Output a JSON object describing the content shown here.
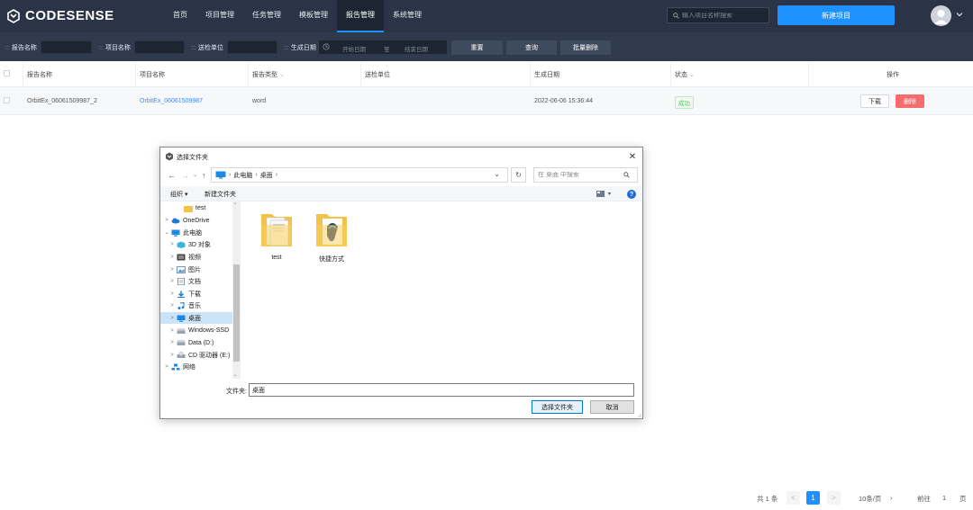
{
  "app": {
    "brand": "CODESENSE",
    "nav": [
      "首页",
      "项目管理",
      "任务管理",
      "模板管理",
      "报告管理",
      "系统管理"
    ],
    "active_nav": "报告管理",
    "search_placeholder": "输入项目名称搜索",
    "new_project_label": "新建项目",
    "accent_color": "#1e90ff"
  },
  "filters": {
    "report_name_label": "报告名称",
    "project_name_label": "项目名称",
    "unit_label": "送检单位",
    "date_label": "生成日期",
    "date_start_placeholder": "开始日期",
    "date_separator": "至",
    "date_end_placeholder": "结束日期",
    "reset_label": "重置",
    "query_label": "查询",
    "batch_delete_label": "批量删除"
  },
  "table": {
    "columns": [
      "报告名称",
      "项目名称",
      "报告类型",
      "送检单位",
      "生成日期",
      "状态",
      "操作"
    ],
    "rows": [
      {
        "report_name": "OrbitEx_06061509987_2",
        "project_name": "OrbitEx_06061509987",
        "report_type": "word",
        "unit": "",
        "date": "2022-06-06 15:36:44",
        "status": "成功",
        "download_label": "下载",
        "delete_label": "删除"
      }
    ]
  },
  "pagination": {
    "total": "共 1 条",
    "prev": "<",
    "current": "1",
    "next": ">",
    "page_size": "10条/页",
    "page_size_caret": "›",
    "goto_label": "前往",
    "goto_value": "1",
    "page_suffix": "页"
  },
  "dialog": {
    "title": "选择文件夹",
    "close": "✕",
    "nav_back": "←",
    "nav_forward": "→",
    "nav_down": "⌄",
    "nav_up": "↑",
    "path": [
      "此电脑",
      "桌面"
    ],
    "path_sep": "›",
    "addr_dropdown": "⌄",
    "refresh": "↻",
    "search_placeholder": "在 桌面 中搜索",
    "organize_label": "组织 ▾",
    "new_folder_label": "新建文件夹",
    "view_caret": "▾",
    "help": "?",
    "tree": [
      {
        "label": "test",
        "icon": "folder-icon",
        "chev": "",
        "indent": 16
      },
      {
        "label": "OneDrive",
        "icon": "cloud-icon",
        "chev": ">",
        "indent": 2
      },
      {
        "label": "此电脑",
        "icon": "pc-icon",
        "chev": "⌄",
        "indent": 2
      },
      {
        "label": "3D 对象",
        "icon": "cube-icon",
        "chev": ">",
        "indent": 8
      },
      {
        "label": "视频",
        "icon": "video-icon",
        "chev": ">",
        "indent": 8
      },
      {
        "label": "图片",
        "icon": "picture-icon",
        "chev": ">",
        "indent": 8
      },
      {
        "label": "文档",
        "icon": "document-icon",
        "chev": ">",
        "indent": 8
      },
      {
        "label": "下载",
        "icon": "download-icon",
        "chev": ">",
        "indent": 8
      },
      {
        "label": "音乐",
        "icon": "music-icon",
        "chev": ">",
        "indent": 8
      },
      {
        "label": "桌面",
        "icon": "desktop-icon",
        "chev": ">",
        "indent": 8,
        "selected": true
      },
      {
        "label": "Windows-SSD",
        "icon": "drive-icon",
        "chev": ">",
        "indent": 8
      },
      {
        "label": "Data (D:)",
        "icon": "drive-icon",
        "chev": ">",
        "indent": 8
      },
      {
        "label": "CD 驱动器 (E:)",
        "icon": "cd-drive-icon",
        "chev": ">",
        "indent": 8
      },
      {
        "label": "网络",
        "icon": "network-icon",
        "chev": ">",
        "indent": 2
      }
    ],
    "files": [
      {
        "label": "test"
      },
      {
        "label": "快捷方式"
      }
    ],
    "folder_label": "文件夹:",
    "folder_value": "桌面",
    "select_label": "选择文件夹",
    "cancel_label": "取消"
  }
}
